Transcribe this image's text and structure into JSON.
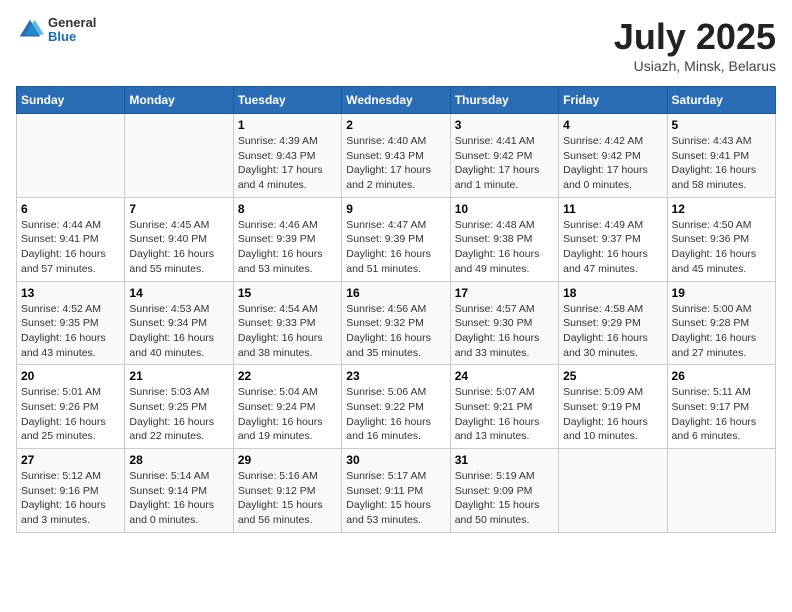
{
  "logo": {
    "general": "General",
    "blue": "Blue"
  },
  "title": "July 2025",
  "subtitle": "Usiazh, Minsk, Belarus",
  "days_of_week": [
    "Sunday",
    "Monday",
    "Tuesday",
    "Wednesday",
    "Thursday",
    "Friday",
    "Saturday"
  ],
  "weeks": [
    [
      {
        "day": "",
        "info": ""
      },
      {
        "day": "",
        "info": ""
      },
      {
        "day": "1",
        "info": "Sunrise: 4:39 AM\nSunset: 9:43 PM\nDaylight: 17 hours\nand 4 minutes."
      },
      {
        "day": "2",
        "info": "Sunrise: 4:40 AM\nSunset: 9:43 PM\nDaylight: 17 hours\nand 2 minutes."
      },
      {
        "day": "3",
        "info": "Sunrise: 4:41 AM\nSunset: 9:42 PM\nDaylight: 17 hours\nand 1 minute."
      },
      {
        "day": "4",
        "info": "Sunrise: 4:42 AM\nSunset: 9:42 PM\nDaylight: 17 hours\nand 0 minutes."
      },
      {
        "day": "5",
        "info": "Sunrise: 4:43 AM\nSunset: 9:41 PM\nDaylight: 16 hours\nand 58 minutes."
      }
    ],
    [
      {
        "day": "6",
        "info": "Sunrise: 4:44 AM\nSunset: 9:41 PM\nDaylight: 16 hours\nand 57 minutes."
      },
      {
        "day": "7",
        "info": "Sunrise: 4:45 AM\nSunset: 9:40 PM\nDaylight: 16 hours\nand 55 minutes."
      },
      {
        "day": "8",
        "info": "Sunrise: 4:46 AM\nSunset: 9:39 PM\nDaylight: 16 hours\nand 53 minutes."
      },
      {
        "day": "9",
        "info": "Sunrise: 4:47 AM\nSunset: 9:39 PM\nDaylight: 16 hours\nand 51 minutes."
      },
      {
        "day": "10",
        "info": "Sunrise: 4:48 AM\nSunset: 9:38 PM\nDaylight: 16 hours\nand 49 minutes."
      },
      {
        "day": "11",
        "info": "Sunrise: 4:49 AM\nSunset: 9:37 PM\nDaylight: 16 hours\nand 47 minutes."
      },
      {
        "day": "12",
        "info": "Sunrise: 4:50 AM\nSunset: 9:36 PM\nDaylight: 16 hours\nand 45 minutes."
      }
    ],
    [
      {
        "day": "13",
        "info": "Sunrise: 4:52 AM\nSunset: 9:35 PM\nDaylight: 16 hours\nand 43 minutes."
      },
      {
        "day": "14",
        "info": "Sunrise: 4:53 AM\nSunset: 9:34 PM\nDaylight: 16 hours\nand 40 minutes."
      },
      {
        "day": "15",
        "info": "Sunrise: 4:54 AM\nSunset: 9:33 PM\nDaylight: 16 hours\nand 38 minutes."
      },
      {
        "day": "16",
        "info": "Sunrise: 4:56 AM\nSunset: 9:32 PM\nDaylight: 16 hours\nand 35 minutes."
      },
      {
        "day": "17",
        "info": "Sunrise: 4:57 AM\nSunset: 9:30 PM\nDaylight: 16 hours\nand 33 minutes."
      },
      {
        "day": "18",
        "info": "Sunrise: 4:58 AM\nSunset: 9:29 PM\nDaylight: 16 hours\nand 30 minutes."
      },
      {
        "day": "19",
        "info": "Sunrise: 5:00 AM\nSunset: 9:28 PM\nDaylight: 16 hours\nand 27 minutes."
      }
    ],
    [
      {
        "day": "20",
        "info": "Sunrise: 5:01 AM\nSunset: 9:26 PM\nDaylight: 16 hours\nand 25 minutes."
      },
      {
        "day": "21",
        "info": "Sunrise: 5:03 AM\nSunset: 9:25 PM\nDaylight: 16 hours\nand 22 minutes."
      },
      {
        "day": "22",
        "info": "Sunrise: 5:04 AM\nSunset: 9:24 PM\nDaylight: 16 hours\nand 19 minutes."
      },
      {
        "day": "23",
        "info": "Sunrise: 5:06 AM\nSunset: 9:22 PM\nDaylight: 16 hours\nand 16 minutes."
      },
      {
        "day": "24",
        "info": "Sunrise: 5:07 AM\nSunset: 9:21 PM\nDaylight: 16 hours\nand 13 minutes."
      },
      {
        "day": "25",
        "info": "Sunrise: 5:09 AM\nSunset: 9:19 PM\nDaylight: 16 hours\nand 10 minutes."
      },
      {
        "day": "26",
        "info": "Sunrise: 5:11 AM\nSunset: 9:17 PM\nDaylight: 16 hours\nand 6 minutes."
      }
    ],
    [
      {
        "day": "27",
        "info": "Sunrise: 5:12 AM\nSunset: 9:16 PM\nDaylight: 16 hours\nand 3 minutes."
      },
      {
        "day": "28",
        "info": "Sunrise: 5:14 AM\nSunset: 9:14 PM\nDaylight: 16 hours\nand 0 minutes."
      },
      {
        "day": "29",
        "info": "Sunrise: 5:16 AM\nSunset: 9:12 PM\nDaylight: 15 hours\nand 56 minutes."
      },
      {
        "day": "30",
        "info": "Sunrise: 5:17 AM\nSunset: 9:11 PM\nDaylight: 15 hours\nand 53 minutes."
      },
      {
        "day": "31",
        "info": "Sunrise: 5:19 AM\nSunset: 9:09 PM\nDaylight: 15 hours\nand 50 minutes."
      },
      {
        "day": "",
        "info": ""
      },
      {
        "day": "",
        "info": ""
      }
    ]
  ]
}
